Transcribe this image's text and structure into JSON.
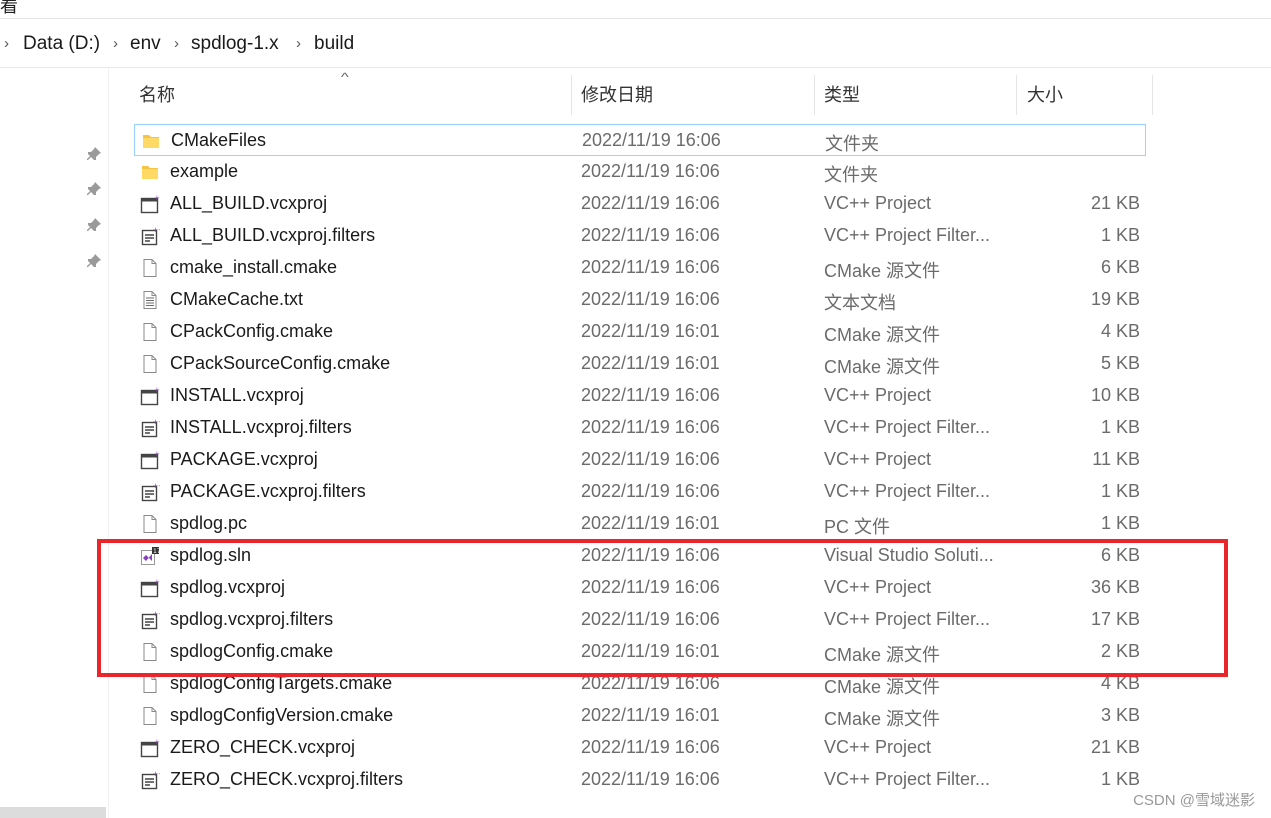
{
  "window": {
    "title_fragment": "看"
  },
  "breadcrumb": [
    "Data (D:)",
    "env",
    "spdlog-1.x",
    "build"
  ],
  "columns": {
    "name": "名称",
    "date": "修改日期",
    "type": "类型",
    "size": "大小"
  },
  "files": [
    {
      "name": "CMakeFiles",
      "date": "2022/11/19 16:06",
      "type": "文件夹",
      "size": "",
      "icon": "folder-icon"
    },
    {
      "name": "example",
      "date": "2022/11/19 16:06",
      "type": "文件夹",
      "size": "",
      "icon": "folder-icon"
    },
    {
      "name": "ALL_BUILD.vcxproj",
      "date": "2022/11/19 16:06",
      "type": "VC++ Project",
      "size": "21 KB",
      "icon": "vcxproj-icon"
    },
    {
      "name": "ALL_BUILD.vcxproj.filters",
      "date": "2022/11/19 16:06",
      "type": "VC++ Project Filter...",
      "size": "1 KB",
      "icon": "filters-icon"
    },
    {
      "name": "cmake_install.cmake",
      "date": "2022/11/19 16:06",
      "type": "CMake 源文件",
      "size": "6 KB",
      "icon": "file-icon"
    },
    {
      "name": "CMakeCache.txt",
      "date": "2022/11/19 16:06",
      "type": "文本文档",
      "size": "19 KB",
      "icon": "text-file-icon"
    },
    {
      "name": "CPackConfig.cmake",
      "date": "2022/11/19 16:01",
      "type": "CMake 源文件",
      "size": "4 KB",
      "icon": "file-icon"
    },
    {
      "name": "CPackSourceConfig.cmake",
      "date": "2022/11/19 16:01",
      "type": "CMake 源文件",
      "size": "5 KB",
      "icon": "file-icon"
    },
    {
      "name": "INSTALL.vcxproj",
      "date": "2022/11/19 16:06",
      "type": "VC++ Project",
      "size": "10 KB",
      "icon": "vcxproj-icon"
    },
    {
      "name": "INSTALL.vcxproj.filters",
      "date": "2022/11/19 16:06",
      "type": "VC++ Project Filter...",
      "size": "1 KB",
      "icon": "filters-icon"
    },
    {
      "name": "PACKAGE.vcxproj",
      "date": "2022/11/19 16:06",
      "type": "VC++ Project",
      "size": "11 KB",
      "icon": "vcxproj-icon"
    },
    {
      "name": "PACKAGE.vcxproj.filters",
      "date": "2022/11/19 16:06",
      "type": "VC++ Project Filter...",
      "size": "1 KB",
      "icon": "filters-icon"
    },
    {
      "name": "spdlog.pc",
      "date": "2022/11/19 16:01",
      "type": "PC 文件",
      "size": "1 KB",
      "icon": "file-icon"
    },
    {
      "name": "spdlog.sln",
      "date": "2022/11/19 16:06",
      "type": "Visual Studio Soluti...",
      "size": "6 KB",
      "icon": "visual-studio-sln-icon"
    },
    {
      "name": "spdlog.vcxproj",
      "date": "2022/11/19 16:06",
      "type": "VC++ Project",
      "size": "36 KB",
      "icon": "vcxproj-icon"
    },
    {
      "name": "spdlog.vcxproj.filters",
      "date": "2022/11/19 16:06",
      "type": "VC++ Project Filter...",
      "size": "17 KB",
      "icon": "filters-icon"
    },
    {
      "name": "spdlogConfig.cmake",
      "date": "2022/11/19 16:01",
      "type": "CMake 源文件",
      "size": "2 KB",
      "icon": "file-icon"
    },
    {
      "name": "spdlogConfigTargets.cmake",
      "date": "2022/11/19 16:06",
      "type": "CMake 源文件",
      "size": "4 KB",
      "icon": "file-icon"
    },
    {
      "name": "spdlogConfigVersion.cmake",
      "date": "2022/11/19 16:01",
      "type": "CMake 源文件",
      "size": "3 KB",
      "icon": "file-icon"
    },
    {
      "name": "ZERO_CHECK.vcxproj",
      "date": "2022/11/19 16:06",
      "type": "VC++ Project",
      "size": "21 KB",
      "icon": "vcxproj-icon"
    },
    {
      "name": "ZERO_CHECK.vcxproj.filters",
      "date": "2022/11/19 16:06",
      "type": "VC++ Project Filter...",
      "size": "1 KB",
      "icon": "filters-icon"
    }
  ],
  "watermark": "CSDN @雪域迷影",
  "colors": {
    "highlight": "#e8262b",
    "selection_border": "#99d1ff",
    "folder": "#f6c343"
  }
}
